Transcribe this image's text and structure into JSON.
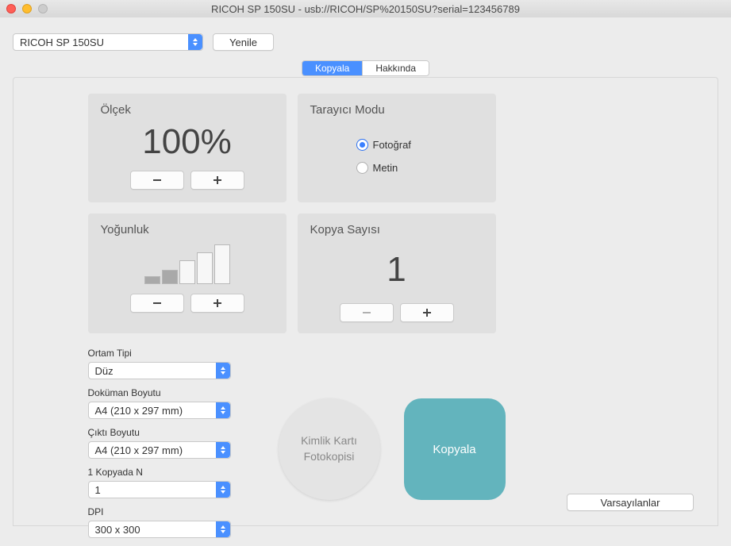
{
  "window": {
    "title": "RICOH SP 150SU - usb://RICOH/SP%20150SU?serial=123456789"
  },
  "toolbar": {
    "printer_selected": "RICOH SP 150SU",
    "refresh_label": "Yenile"
  },
  "tabs": {
    "copy_label": "Kopyala",
    "about_label": "Hakkında"
  },
  "scale": {
    "title": "Ölçek",
    "value": "100%"
  },
  "scanner_mode": {
    "title": "Tarayıcı Modu",
    "option_photo": "Fotoğraf",
    "option_text": "Metin"
  },
  "density": {
    "title": "Yoğunluk"
  },
  "copies": {
    "title": "Kopya Sayısı",
    "value": "1"
  },
  "settings": {
    "media_type_label": "Ortam Tipi",
    "media_type_value": "Düz",
    "doc_size_label": "Doküman Boyutu",
    "doc_size_value": "A4 (210 x 297 mm)",
    "output_size_label": "Çıktı Boyutu",
    "output_size_value": "A4 (210 x 297 mm)",
    "nup_label": "1 Kopyada N",
    "nup_value": "1",
    "dpi_label": "DPI",
    "dpi_value": "300 x 300"
  },
  "actions": {
    "id_card_label_line1": "Kimlik Kartı",
    "id_card_label_line2": "Fotokopisi",
    "copy_label": "Kopyala",
    "defaults_label": "Varsayılanlar"
  }
}
